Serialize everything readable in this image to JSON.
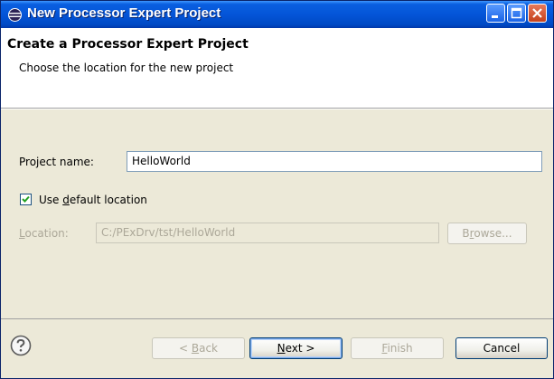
{
  "window": {
    "title": "New Processor Expert Project"
  },
  "header": {
    "title": "Create a Processor Expert Project",
    "description": "Choose the location for the new project"
  },
  "form": {
    "project_name_label": "Project name:",
    "project_name_value": "HelloWorld",
    "use_default_location_label_pre": "Use ",
    "use_default_location_label_u": "d",
    "use_default_location_label_post": "efault location",
    "use_default_location_checked": true,
    "location_label_u": "L",
    "location_label_post": "ocation:",
    "location_value": "C:/PExDrv/tst/HelloWorld",
    "browse_pre": "B",
    "browse_u": "r",
    "browse_post": "owse..."
  },
  "buttons": {
    "back_pre": "< ",
    "back_u": "B",
    "back_post": "ack",
    "next_u": "N",
    "next_post": "ext >",
    "finish_u": "F",
    "finish_post": "inish",
    "cancel": "Cancel"
  },
  "icons": {
    "app": "eclipse-icon",
    "help": "help-icon",
    "minimize": "minimize-icon",
    "maximize": "maximize-icon",
    "close": "close-icon"
  },
  "colors": {
    "titlebar": "#0455d8",
    "dialog_bg": "#ece9d8",
    "close_button": "#c4401c"
  }
}
